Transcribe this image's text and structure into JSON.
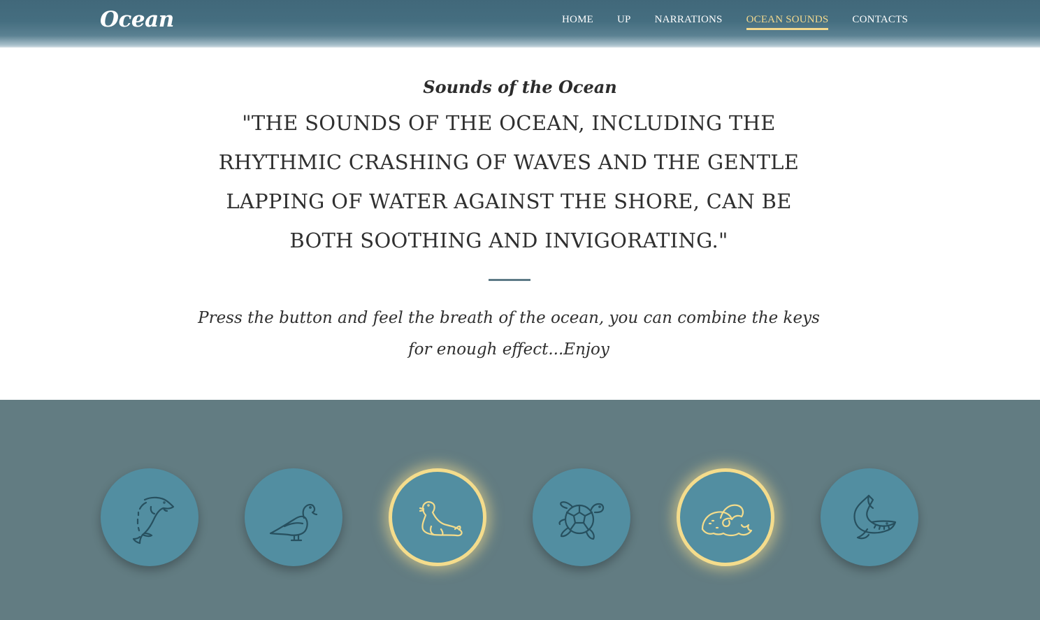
{
  "header": {
    "logo": "Ocean",
    "nav": [
      {
        "label": "HOME"
      },
      {
        "label": "UP"
      },
      {
        "label": "NARRATIONS"
      },
      {
        "label": "OCEAN SOUNDS",
        "active": true
      },
      {
        "label": "CONTACTS"
      }
    ]
  },
  "intro": {
    "subtitle": "Sounds of the Ocean",
    "quote": "\"The sounds of the ocean, including the rhythmic crashing of waves and the gentle lapping of water against the shore, can be both soothing and invigorating.\"",
    "note": "Press the button and feel the breath of the ocean, you can combine the keys for enough effect...Enjoy"
  },
  "sound_buttons": [
    {
      "icon": "dolphin-icon",
      "active": false
    },
    {
      "icon": "seagull-icon",
      "active": false
    },
    {
      "icon": "seal-icon",
      "active": true
    },
    {
      "icon": "turtle-icon",
      "active": false
    },
    {
      "icon": "wave-icon",
      "active": true
    },
    {
      "icon": "whale-icon",
      "active": false
    }
  ],
  "colors": {
    "header": "#41687a",
    "accent": "#f4dc8c",
    "sound_section": "#627c82",
    "button": "#528ea1",
    "icon_stroke": "#27505f",
    "text": "#2f2f2f"
  }
}
